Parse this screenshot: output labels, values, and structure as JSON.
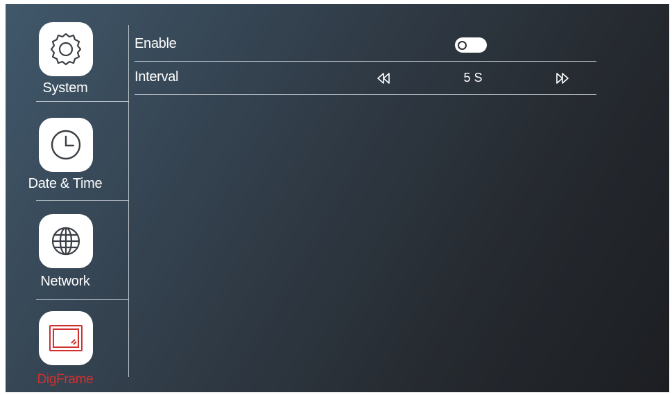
{
  "sidebar": {
    "items": [
      {
        "label": "System",
        "icon": "gear-icon",
        "active": false
      },
      {
        "label": "Date & Time",
        "icon": "clock-icon",
        "active": false
      },
      {
        "label": "Network",
        "icon": "globe-icon",
        "active": false
      },
      {
        "label": "DigFrame",
        "icon": "digital-frame-icon",
        "active": true
      }
    ]
  },
  "settings": {
    "enable": {
      "label": "Enable",
      "state": "off"
    },
    "interval": {
      "label": "Interval",
      "value": "5 S",
      "prev_icon": "double-chevron-left-icon",
      "next_icon": "double-chevron-right-icon"
    }
  },
  "colors": {
    "accent": "#d0312f",
    "text": "#ffffff",
    "divider": "#cfd6dc"
  }
}
